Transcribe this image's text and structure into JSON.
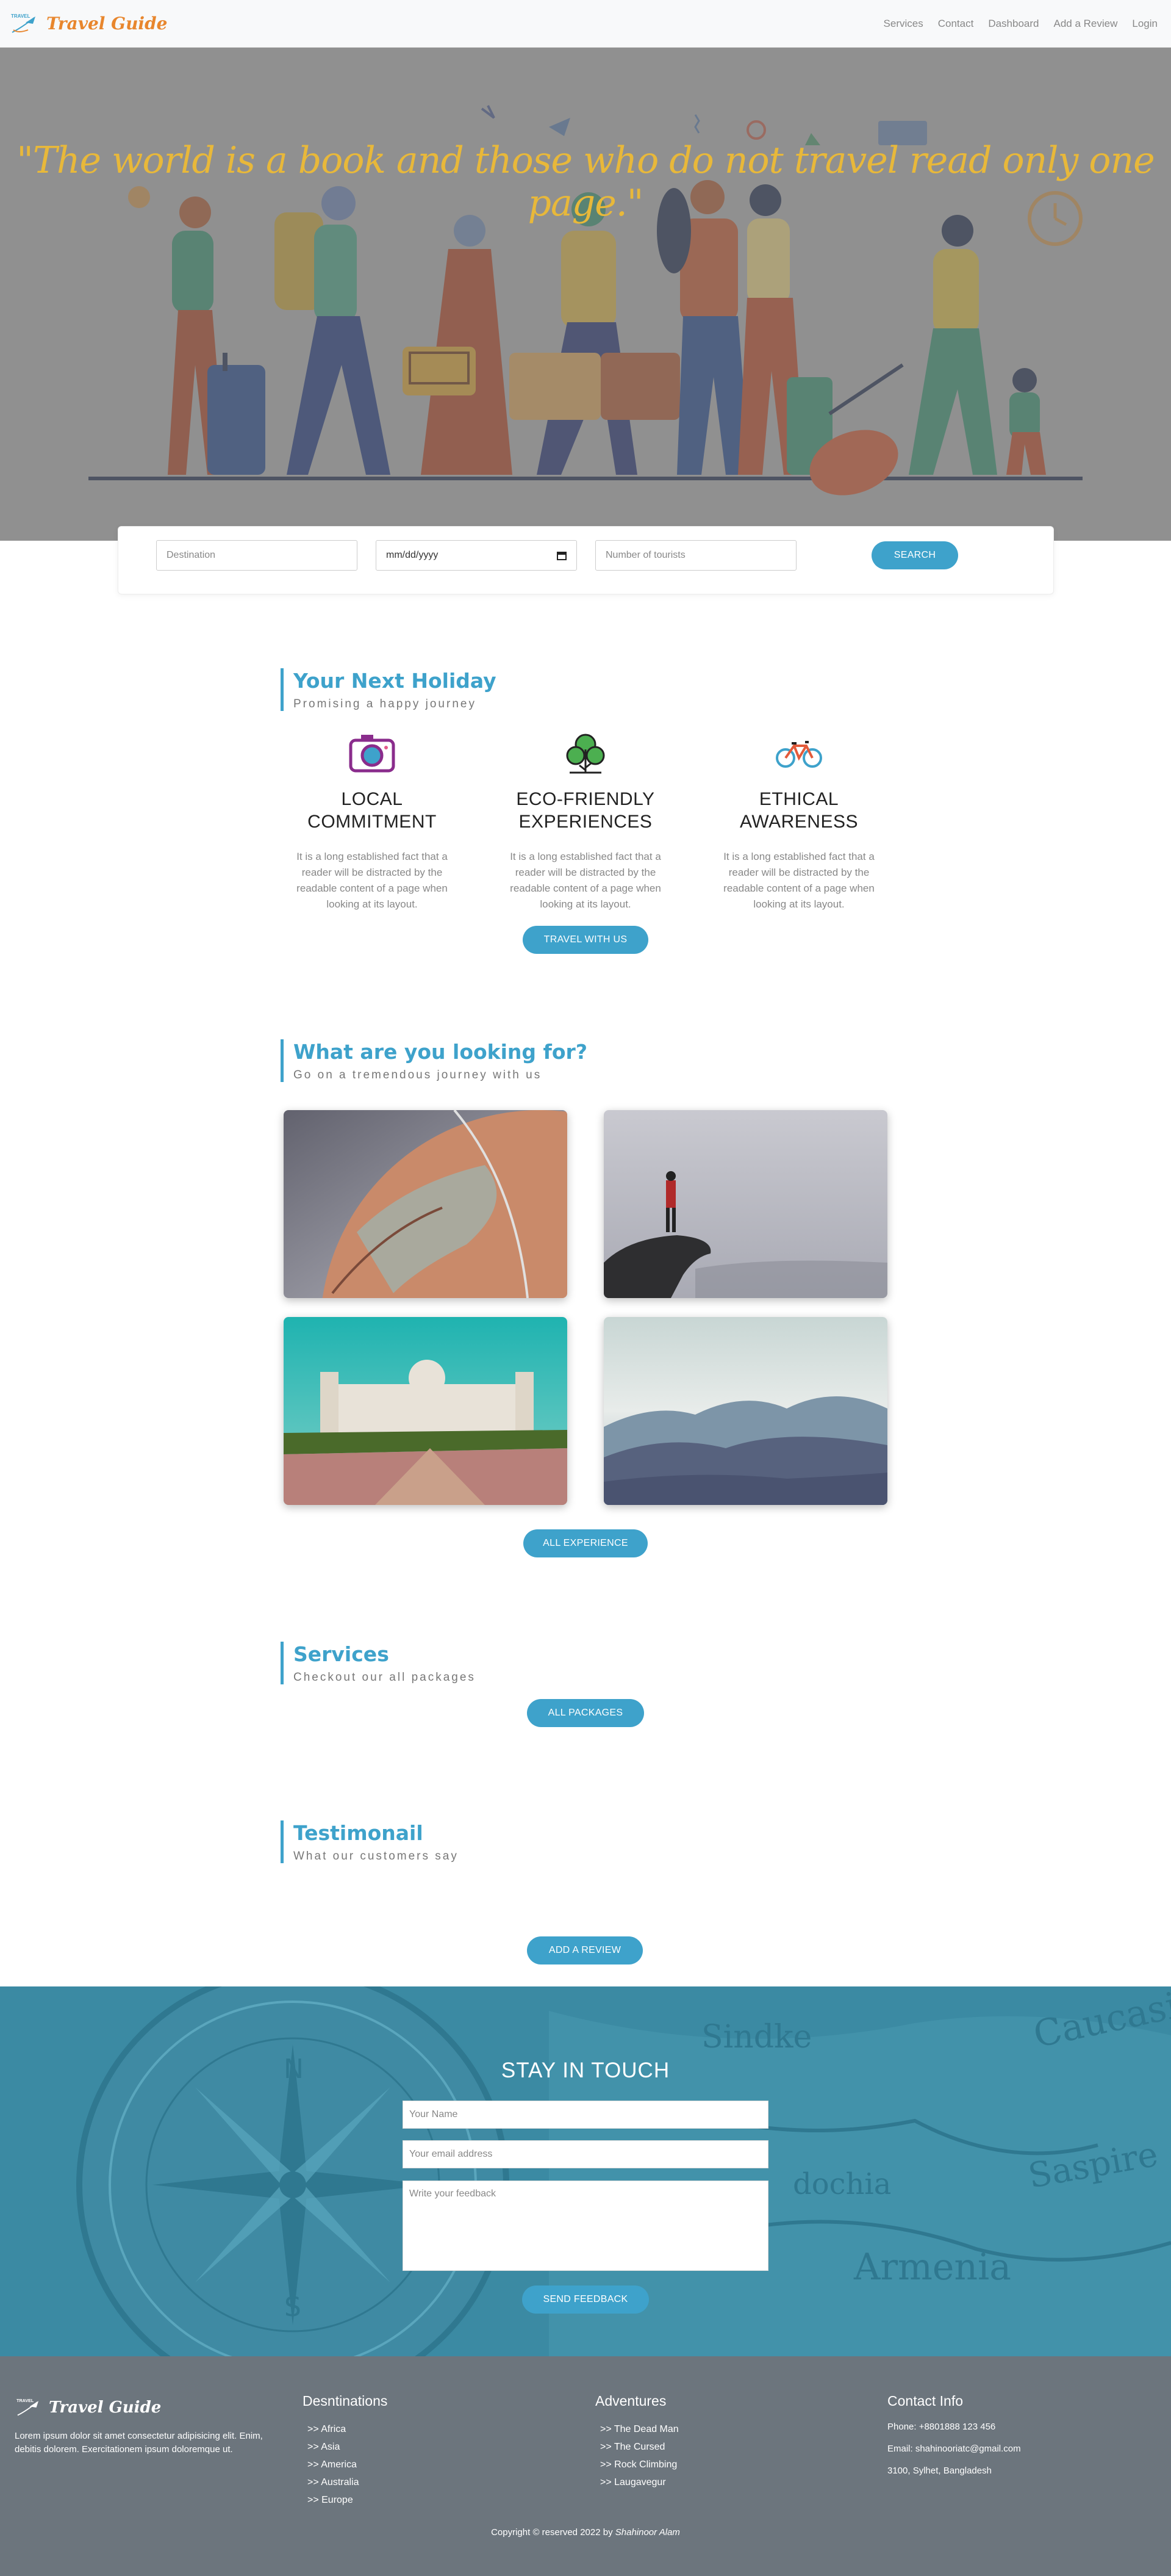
{
  "nav": {
    "brand_name": "Travel Guide",
    "logo_text": "TRAVEL",
    "links": [
      "Services",
      "Contact",
      "Dashboard",
      "Add a Review",
      "Login"
    ]
  },
  "hero": {
    "quote": "\"The world is a book and those who do not travel read only one page.\""
  },
  "search": {
    "destination_placeholder": "Destination",
    "date_placeholder": "mm/dd/yyyy",
    "tourists_placeholder": "Number of tourists",
    "button_label": "SEARCH"
  },
  "holiday": {
    "title": "Your Next Holiday",
    "subtitle": "Promising a happy journey",
    "features": [
      {
        "icon": "camera-icon",
        "title_line1": "LOCAL",
        "title_line2": "COMMITMENT",
        "text": "It is a long established fact that a reader will be distracted by the readable content of a page when looking at its layout."
      },
      {
        "icon": "tree-icon",
        "title_line1": "ECO-FRIENDLY",
        "title_line2": "EXPERIENCES",
        "text": "It is a long established fact that a reader will be distracted by the readable content of a page when looking at its layout."
      },
      {
        "icon": "bicycle-icon",
        "title_line1": "ETHICAL",
        "title_line2": "AWARENESS",
        "text": "It is a long established fact that a reader will be distracted by the readable content of a page when looking at its layout."
      }
    ],
    "button_label": "TRAVEL WITH US"
  },
  "looking": {
    "title": "What are you looking for?",
    "subtitle": "Go on a tremendous journey with us",
    "button_label": "ALL EXPERIENCE"
  },
  "services": {
    "title": "Services",
    "subtitle": "Checkout our all packages",
    "button_label": "ALL PACKAGES"
  },
  "testimonial": {
    "title": "Testimonail",
    "subtitle": "What our customers say",
    "button_label": "ADD A REVIEW"
  },
  "touch": {
    "title": "STAY IN TOUCH",
    "name_placeholder": "Your Name",
    "email_placeholder": "Your email address",
    "feedback_placeholder": "Write your feedback",
    "button_label": "SEND FEEDBACK"
  },
  "footer": {
    "brand_name": "Travel Guide",
    "about": "Lorem ipsum dolor sit amet consectetur adipisicing elit. Enim, debitis dolorem. Exercitationem ipsum doloremque ut.",
    "destinations_title": "Desntinations",
    "destinations": [
      ">> Africa",
      ">> Asia",
      ">> America",
      ">> Australia",
      ">> Europe"
    ],
    "adventures_title": "Adventures",
    "adventures": [
      ">> The Dead Man",
      ">> The Cursed",
      ">> Rock Climbing",
      ">> Laugavegur"
    ],
    "contact_title": "Contact Info",
    "phone": "Phone: +8801888 123 456",
    "email": "Email: shahinooriatc@gmail.com",
    "address": "3100, Sylhet, Bangladesh",
    "copyright_prefix": "Copyright © reserved 2022 by ",
    "copyright_author": "Shahinoor Alam"
  },
  "colors": {
    "accent": "#3ea2cb",
    "brand": "#e8862d",
    "quote": "#e8b83a",
    "footer_bg": "#6c757d"
  }
}
